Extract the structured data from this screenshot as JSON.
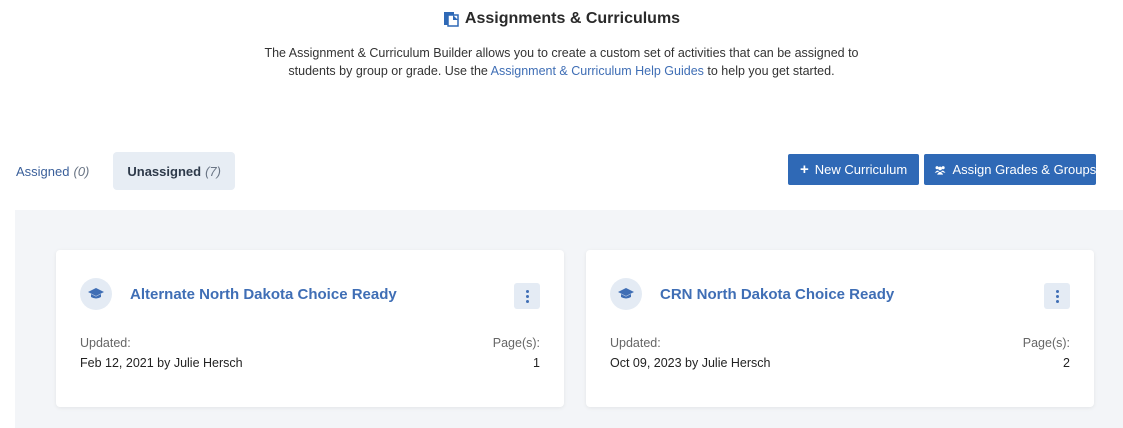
{
  "header": {
    "title": "Assignments & Curriculums",
    "description_line1": "The Assignment & Curriculum Builder allows you to create a custom set of activities that can be assigned to",
    "description_line2_pre": "students by group or grade. Use the ",
    "help_link": "Assignment & Curriculum Help Guides",
    "description_line2_post": " to help you get started."
  },
  "tabs": [
    {
      "label": "Assigned",
      "count": "(0)"
    },
    {
      "label": "Unassigned",
      "count": "(7)"
    }
  ],
  "actions": {
    "new_curriculum": "New Curriculum",
    "assign": "Assign Grades & Groups"
  },
  "cards": [
    {
      "title": "Alternate North Dakota Choice Ready",
      "updated_label": "Updated:",
      "updated_value": "Feb 12, 2021 by Julie Hersch",
      "pages_label": "Page(s):",
      "pages_value": "1"
    },
    {
      "title": "CRN North Dakota Choice Ready",
      "updated_label": "Updated:",
      "updated_value": "Oct 09, 2023 by Julie Hersch",
      "pages_label": "Page(s):",
      "pages_value": "2"
    }
  ],
  "colors": {
    "accent": "#2f69b6",
    "link": "#3f6eb5",
    "panel_bg": "#f3f5f8"
  },
  "icons": {
    "title": "clipboard-icon",
    "card": "graduation-cap-icon",
    "menu": "kebab-menu-icon",
    "assign": "users-icon"
  }
}
